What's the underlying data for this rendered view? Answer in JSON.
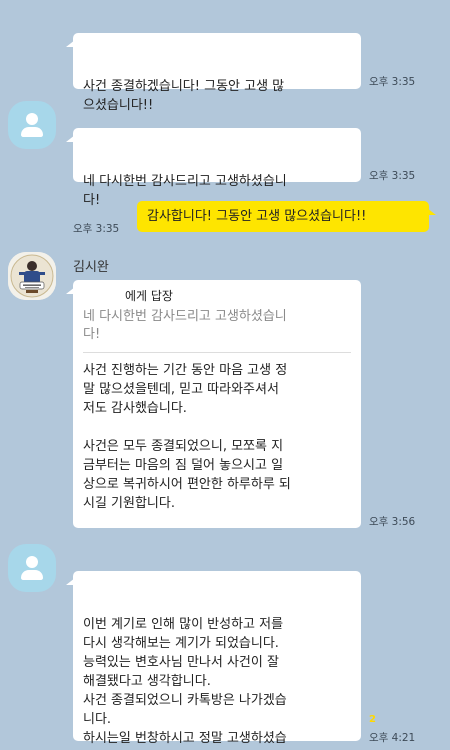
{
  "colors": {
    "background": "#b2c7da",
    "bubble_other": "#ffffff",
    "bubble_mine": "#fee500",
    "unread": "#ffd800"
  },
  "messages": [
    {
      "text": "사건 종결하겠습니다! 그동안 고생 많\n으셨습니다!!",
      "time": "오후 3:35"
    },
    {
      "text": "네 다시한번 감사드리고 고생하셨습니\n다!",
      "time": "오후 3:35"
    },
    {
      "text": "감사합니다! 그동안 고생 많으셨습니다!!",
      "time": "오후 3:35"
    },
    {
      "sender": "김시완",
      "reply": {
        "to": "에게 답장",
        "quote": "네 다시한번 감사드리고 고생하셨습니\n다!"
      },
      "text": "사건 진행하는 기간 동안 마음 고생 정\n말 많으셨을텐데, 믿고 따라와주셔서\n저도 감사했습니다.\n\n사건은 모두 종결되었으니, 모쪼록 지\n금부터는 마음의 짐 덜어 놓으시고 일\n상으로 복귀하시어 편안한 하루하루 되\n시길 기원합니다.",
      "time": "오후 3:56"
    },
    {
      "text": "이번 계기로 인해 많이 반성하고 저를\n다시 생각해보는 계기가 되었습니다.\n능력있는 변호사님 만나서 사건이 잘\n해결됐다고 생각합니다.\n사건 종결되었으니 카톡방은 나가겠습\n니다.\n하시는일 번창하시고 정말 고생하셨습\n니다!",
      "time": "오후 4:21",
      "unread": "2"
    }
  ],
  "icons": {
    "avatar_default": "person-icon",
    "avatar_profile": "profile-photo-icon"
  }
}
